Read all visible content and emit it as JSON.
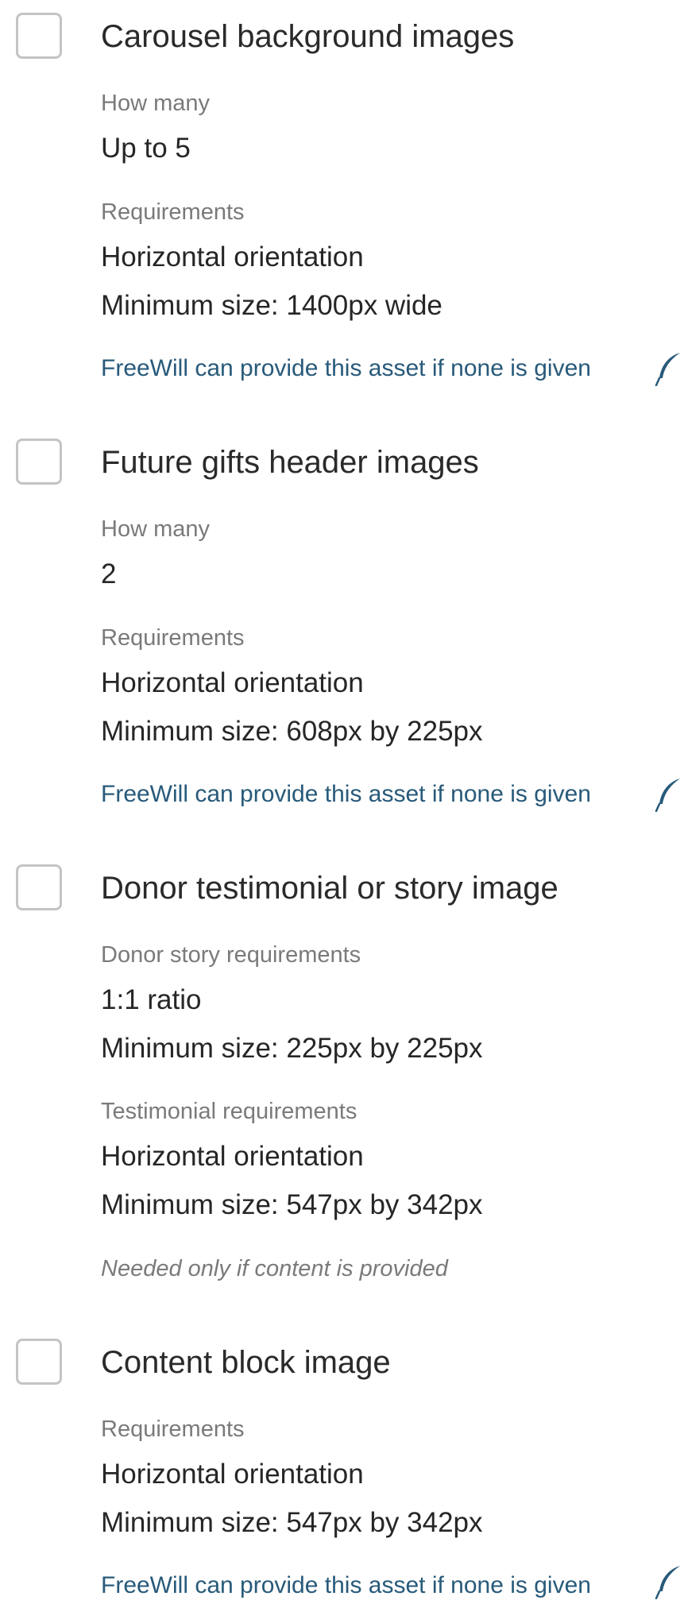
{
  "items": [
    {
      "title": "Carousel background images",
      "how_many_label": "How many",
      "how_many_value": "Up to 5",
      "requirements_label": "Requirements",
      "requirements": [
        "Horizontal orientation",
        "Minimum size: 1400px wide"
      ],
      "note": "FreeWill can provide this asset if none is given",
      "note_icon": "quill-icon"
    },
    {
      "title": "Future gifts header images",
      "how_many_label": "How many",
      "how_many_value": "2",
      "requirements_label": "Requirements",
      "requirements": [
        "Horizontal orientation",
        "Minimum size: 608px by 225px"
      ],
      "note": "FreeWill can provide this asset if none is given",
      "note_icon": "quill-icon"
    },
    {
      "title": "Donor testimonial or story image",
      "donor_story_label": "Donor story requirements",
      "donor_story_requirements": [
        "1:1 ratio",
        "Minimum size: 225px by 225px"
      ],
      "testimonial_label": "Testimonial requirements",
      "testimonial_requirements": [
        "Horizontal orientation",
        "Minimum size: 547px by 342px"
      ],
      "note": "Needed only if content is provided"
    },
    {
      "title": "Content block image",
      "requirements_label": "Requirements",
      "requirements": [
        "Horizontal orientation",
        "Minimum size: 547px by 342px"
      ],
      "note": "FreeWill can provide this asset if none is given",
      "note_icon": "quill-icon"
    }
  ],
  "colors": {
    "link": "#285a7a",
    "label": "#7a7a7a",
    "checkbox_border": "#c4c4c4"
  }
}
